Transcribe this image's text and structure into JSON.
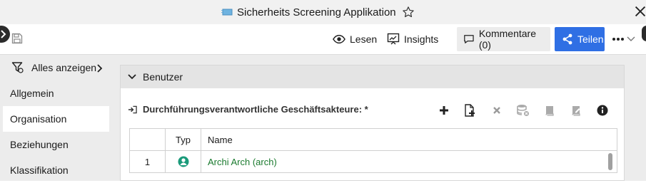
{
  "window": {
    "title": "Sicherheits Screening Applikation",
    "icons": [
      "app-icon",
      "star-icon",
      "close-icon"
    ]
  },
  "toolbar": {
    "read_label": "Lesen",
    "insights_label": "Insights",
    "comments_label": "Kommentare (0)",
    "share_label": "Teilen",
    "colors": {
      "share_bg": "#2f6fe4",
      "comments_bg": "#ececec"
    }
  },
  "sidebar": {
    "filter_label": "Alles anzeigen",
    "items": [
      {
        "label": "Allgemein",
        "active": false
      },
      {
        "label": "Organisation",
        "active": true
      },
      {
        "label": "Beziehungen",
        "active": false
      },
      {
        "label": "Klassifikation",
        "active": false
      }
    ]
  },
  "panel": {
    "title": "Benutzer",
    "section_label": "Durchführungsverantwortliche Geschäftsakteure: *",
    "actions": [
      "add-icon",
      "new-document-icon",
      "remove-icon",
      "database-remove-icon",
      "book-icon",
      "book-edit-icon",
      "info-icon"
    ],
    "table": {
      "columns": [
        "",
        "Typ",
        "Name"
      ],
      "rows": [
        {
          "index": "1",
          "type_icon": "user-icon",
          "name": "Archi Arch (arch)"
        }
      ]
    },
    "colors": {
      "link": "#1a7a2e",
      "user_icon": "#1a9a7a"
    }
  }
}
